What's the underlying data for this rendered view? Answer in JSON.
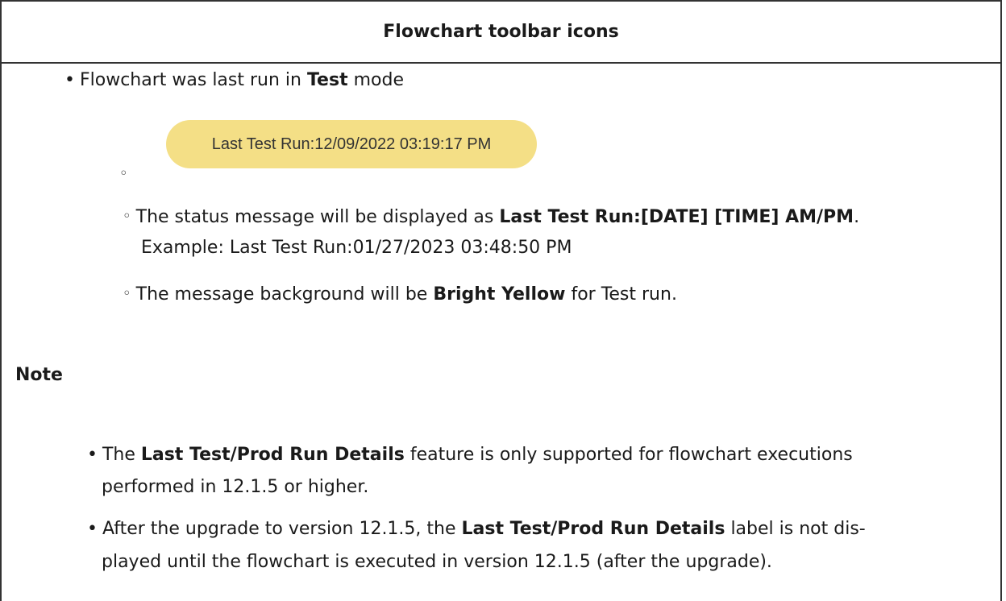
{
  "header": {
    "title": "Flowchart toolbar icons"
  },
  "intro": {
    "bullet": "•",
    "text_before": "Flowchart was last run in ",
    "mode": "Test",
    "text_after": " mode"
  },
  "status_pill": {
    "text": "Last Test Run:12/09/2022 03:19:17 PM"
  },
  "empty_sub_bullet": "◦",
  "sub_items": [
    {
      "bullet": "◦",
      "text_before": "The status message will be displayed as ",
      "bold": "Last Test Run:[DATE] [TIME] AM/PM",
      "text_after": ".",
      "continuation": "Example: Last Test Run:01/27/2023 03:48:50 PM"
    },
    {
      "bullet": "◦",
      "text_before": "The message background will be ",
      "bold": "Bright Yellow",
      "text_after": " for Test run."
    }
  ],
  "note": {
    "title": "Note",
    "items": [
      {
        "bullet": "•",
        "text_before": "The ",
        "bold": "Last Test/Prod Run Details",
        "text_after": " feature is only supported for flowchart executions",
        "continuation": "performed in 12.1.5 or higher."
      },
      {
        "bullet": "•",
        "text_before": "After the upgrade to version 12.1.5, the ",
        "bold": "Last Test/Prod Run Details",
        "text_after": " label is not dis-",
        "continuation": "played until the flowchart is executed in version 12.1.5 (after the upgrade)."
      }
    ]
  },
  "colors": {
    "pill_background": "#f4df86",
    "border": "#333333"
  }
}
